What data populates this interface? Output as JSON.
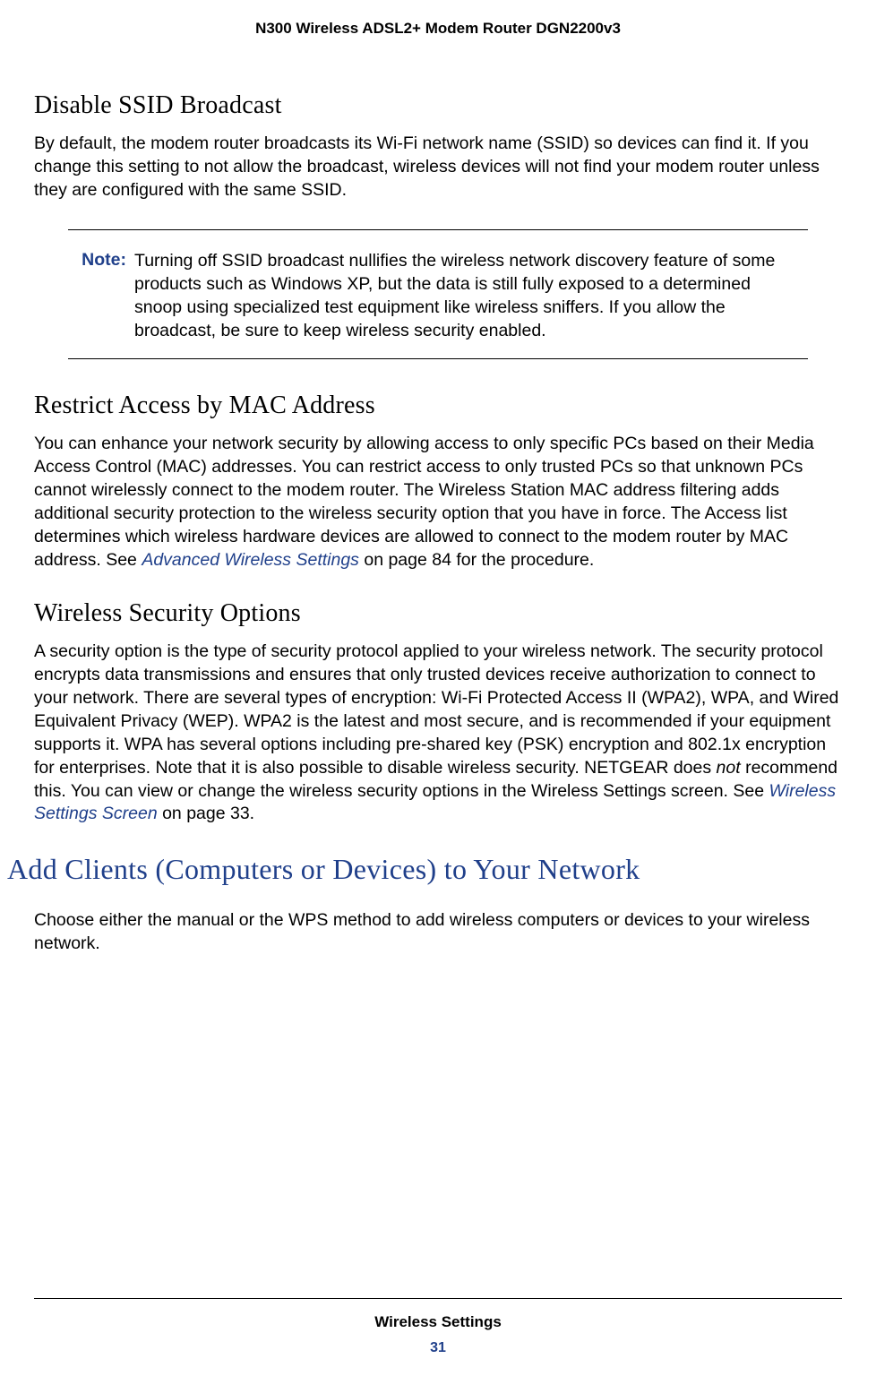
{
  "header": {
    "title": "N300 Wireless ADSL2+ Modem Router DGN2200v3"
  },
  "sections": {
    "ssid": {
      "heading": "Disable SSID Broadcast",
      "body": "By default, the modem router broadcasts its Wi-Fi network name (SSID) so devices can find it. If you change this setting to not allow the broadcast, wireless devices will not find your modem router unless they are configured with the same SSID."
    },
    "note": {
      "label": "Note:",
      "body": "Turning off SSID broadcast nullifies the wireless network discovery feature of some products such as Windows XP, but the data is still fully exposed to a determined snoop using specialized test equipment like wireless sniffers. If you allow the broadcast, be sure to keep wireless security enabled."
    },
    "mac": {
      "heading": "Restrict Access by MAC Address",
      "body_before_link": "You can enhance your network security by allowing access to only specific PCs based on their Media Access Control (MAC) addresses. You can restrict access to only trusted PCs so that unknown PCs cannot wirelessly connect to the modem router. The Wireless Station MAC address filtering adds additional security protection to the wireless security option that you have in force. The Access list determines which wireless hardware devices are allowed to connect to the modem router by MAC address. See ",
      "link_text": "Advanced Wireless Settings",
      "body_after_link": " on page 84 for the procedure."
    },
    "security": {
      "heading": "Wireless Security Options",
      "body_before_em": "A security option is the type of security protocol applied to your wireless network. The security protocol encrypts data transmissions and ensures that only trusted devices receive authorization to connect to your network. There are several types of encryption: Wi-Fi Protected Access II (WPA2), WPA, and Wired Equivalent Privacy (WEP). WPA2 is the latest and most secure, and is recommended if your equipment supports it. WPA has several options including pre-shared key (PSK) encryption and 802.1x encryption for enterprises. Note that it is also possible to disable wireless security. NETGEAR does ",
      "em_word": "not",
      "body_after_em": " recommend this. You can view or change the wireless security options in the Wireless Settings screen. See ",
      "link_text": "Wireless Settings Screen",
      "body_after_link": " on page 33."
    },
    "add_clients": {
      "heading": "Add Clients (Computers or Devices) to Your Network",
      "body": "Choose either the manual or the WPS method to add wireless computers or devices to your wireless network."
    }
  },
  "footer": {
    "title": "Wireless Settings",
    "page": "31"
  }
}
